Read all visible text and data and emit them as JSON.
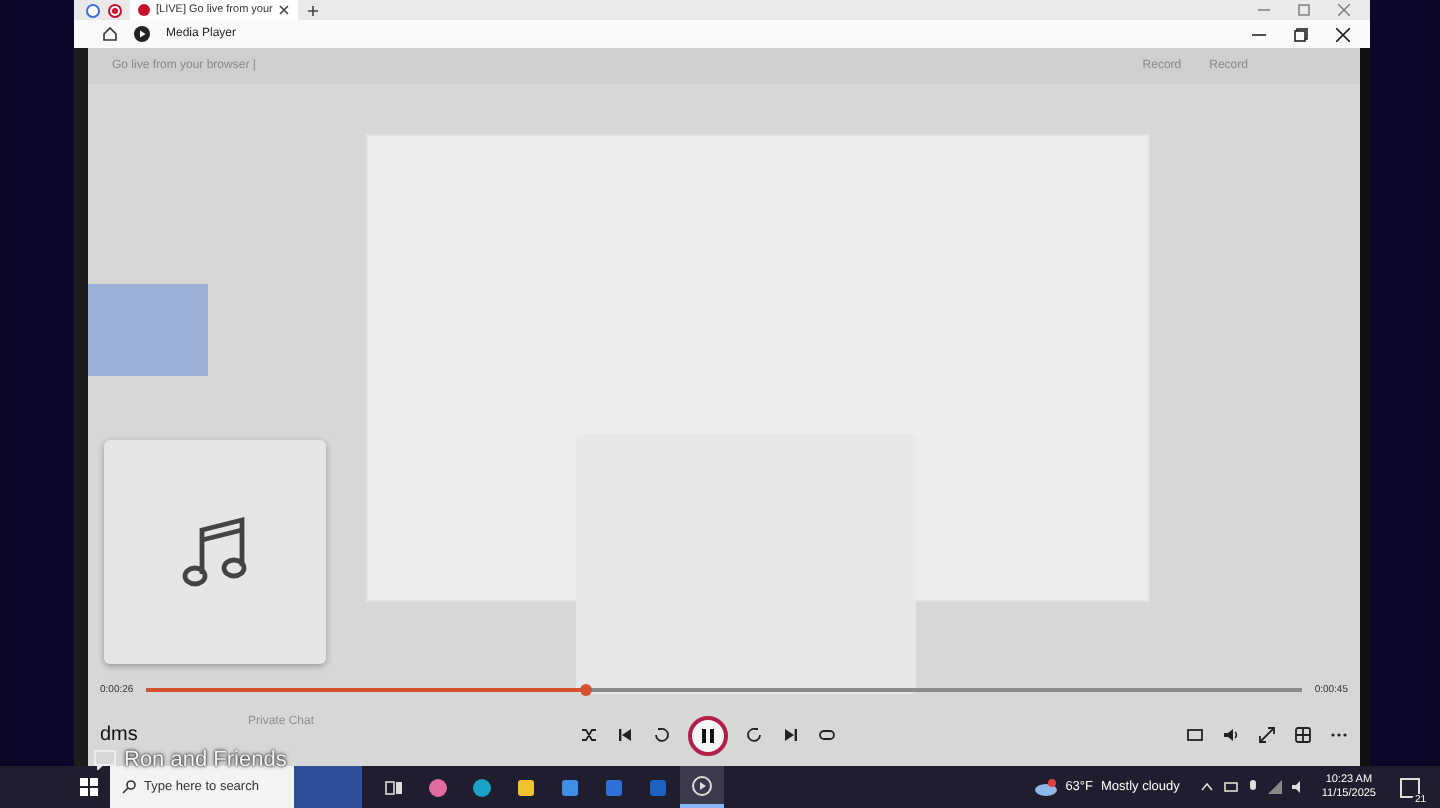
{
  "browser": {
    "tabs": [
      {
        "title": "[LIVE] Go live from your",
        "selected": true
      }
    ]
  },
  "player": {
    "title": "Media Player",
    "background": {
      "page_title": "Go live from your browser |",
      "record_labels": [
        "Record",
        "Record"
      ],
      "chat_label": "Private Chat"
    },
    "elapsed": "0:00:26",
    "duration": "0:00:45",
    "level": 0.38,
    "playing": true,
    "track": "dms"
  },
  "overlay_caption": "Ron and Friends",
  "taskbar": {
    "search_placeholder": "Type here to search",
    "apps": [
      {
        "kind": "taskview",
        "active": false
      },
      {
        "kind": "copilot",
        "active": false
      },
      {
        "kind": "edge",
        "active": false
      },
      {
        "kind": "files",
        "active": false
      },
      {
        "kind": "store",
        "active": false
      },
      {
        "kind": "mail",
        "active": false
      },
      {
        "kind": "outlook",
        "active": false
      },
      {
        "kind": "player",
        "active": true
      }
    ],
    "weather": {
      "temp": "63°F",
      "condition": "Mostly cloudy"
    },
    "time": "10:23 AM",
    "date": "11/15/2025",
    "notifications": "21"
  }
}
